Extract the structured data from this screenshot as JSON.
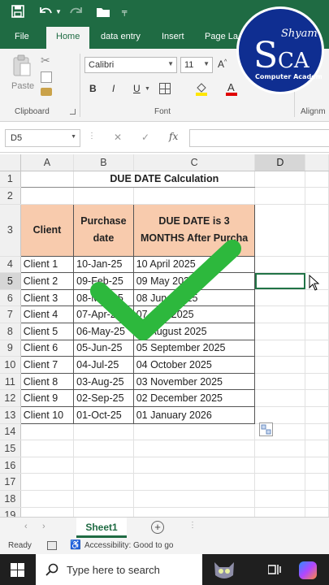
{
  "qat": {
    "undo_icon": "undo-icon",
    "redo_icon": "redo-icon",
    "save_icon": "save-icon"
  },
  "ribbon_tabs": [
    {
      "label": "File"
    },
    {
      "label": "Home"
    },
    {
      "label": "data entry"
    },
    {
      "label": "Insert"
    },
    {
      "label": "Page La"
    }
  ],
  "ribbon": {
    "paste_label": "Paste",
    "clipboard_label": "Clipboard",
    "font_group_label": "Font",
    "alignment_label": "Alignm",
    "font_name": "Calibri",
    "font_size": "11",
    "bold": "B",
    "italic": "I",
    "underline": "U"
  },
  "formula_bar": {
    "name_box": "D5",
    "fx": "fx",
    "cancel": "✕",
    "enter": "✓",
    "formula": ""
  },
  "logo": {
    "line1": "Shyam",
    "letters": "SCA",
    "tagline": "Computer Academy"
  },
  "columns": [
    "A",
    "B",
    "C",
    "D"
  ],
  "rows": [
    {
      "num": "1",
      "a": "",
      "b": "",
      "c": "",
      "d": ""
    },
    {
      "num": "2",
      "a": "",
      "b": "",
      "c": "",
      "d": ""
    },
    {
      "num": "3",
      "a": "Client",
      "b": "Purchase date",
      "c": "DUE DATE is 3 MONTHS After Purcha",
      "d": ""
    },
    {
      "num": "4",
      "a": "Client 1",
      "b": "10-Jan-25",
      "c": "10 April 2025",
      "d": ""
    },
    {
      "num": "5",
      "a": "Client 2",
      "b": "09-Feb-25",
      "c": "09 May 2025",
      "d": ""
    },
    {
      "num": "6",
      "a": "Client 3",
      "b": "08-Mar-25",
      "c": "08 June 2025",
      "d": ""
    },
    {
      "num": "7",
      "a": "Client 4",
      "b": "07-Apr-25",
      "c": "07 July 2025",
      "d": ""
    },
    {
      "num": "8",
      "a": "Client 5",
      "b": "06-May-25",
      "c": "06 August 2025",
      "d": ""
    },
    {
      "num": "9",
      "a": "Client 6",
      "b": "05-Jun-25",
      "c": "05 September 2025",
      "d": ""
    },
    {
      "num": "10",
      "a": "Client 7",
      "b": "04-Jul-25",
      "c": "04 October 2025",
      "d": ""
    },
    {
      "num": "11",
      "a": "Client 8",
      "b": "03-Aug-25",
      "c": "03 November 2025",
      "d": ""
    },
    {
      "num": "12",
      "a": "Client 9",
      "b": "02-Sep-25",
      "c": "02 December 2025",
      "d": ""
    },
    {
      "num": "13",
      "a": "Client 10",
      "b": "01-Oct-25",
      "c": "01 January 2026",
      "d": ""
    },
    {
      "num": "14",
      "a": "",
      "b": "",
      "c": "",
      "d": ""
    },
    {
      "num": "15",
      "a": "",
      "b": "",
      "c": "",
      "d": ""
    },
    {
      "num": "16",
      "a": "",
      "b": "",
      "c": "",
      "d": ""
    },
    {
      "num": "17",
      "a": "",
      "b": "",
      "c": "",
      "d": ""
    },
    {
      "num": "18",
      "a": "",
      "b": "",
      "c": "",
      "d": ""
    },
    {
      "num": "19",
      "a": "",
      "b": "",
      "c": "",
      "d": ""
    }
  ],
  "title_cell": "DUE DATE Calculation",
  "sheet_tab": "Sheet1",
  "status": {
    "ready": "Ready",
    "accessibility": "Accessibility: Good to go"
  },
  "taskbar": {
    "search_placeholder": "Type here to search"
  },
  "colors": {
    "excel_green": "#1f6b43",
    "header_fill": "#f8cbad",
    "check_green": "#2db83d"
  }
}
